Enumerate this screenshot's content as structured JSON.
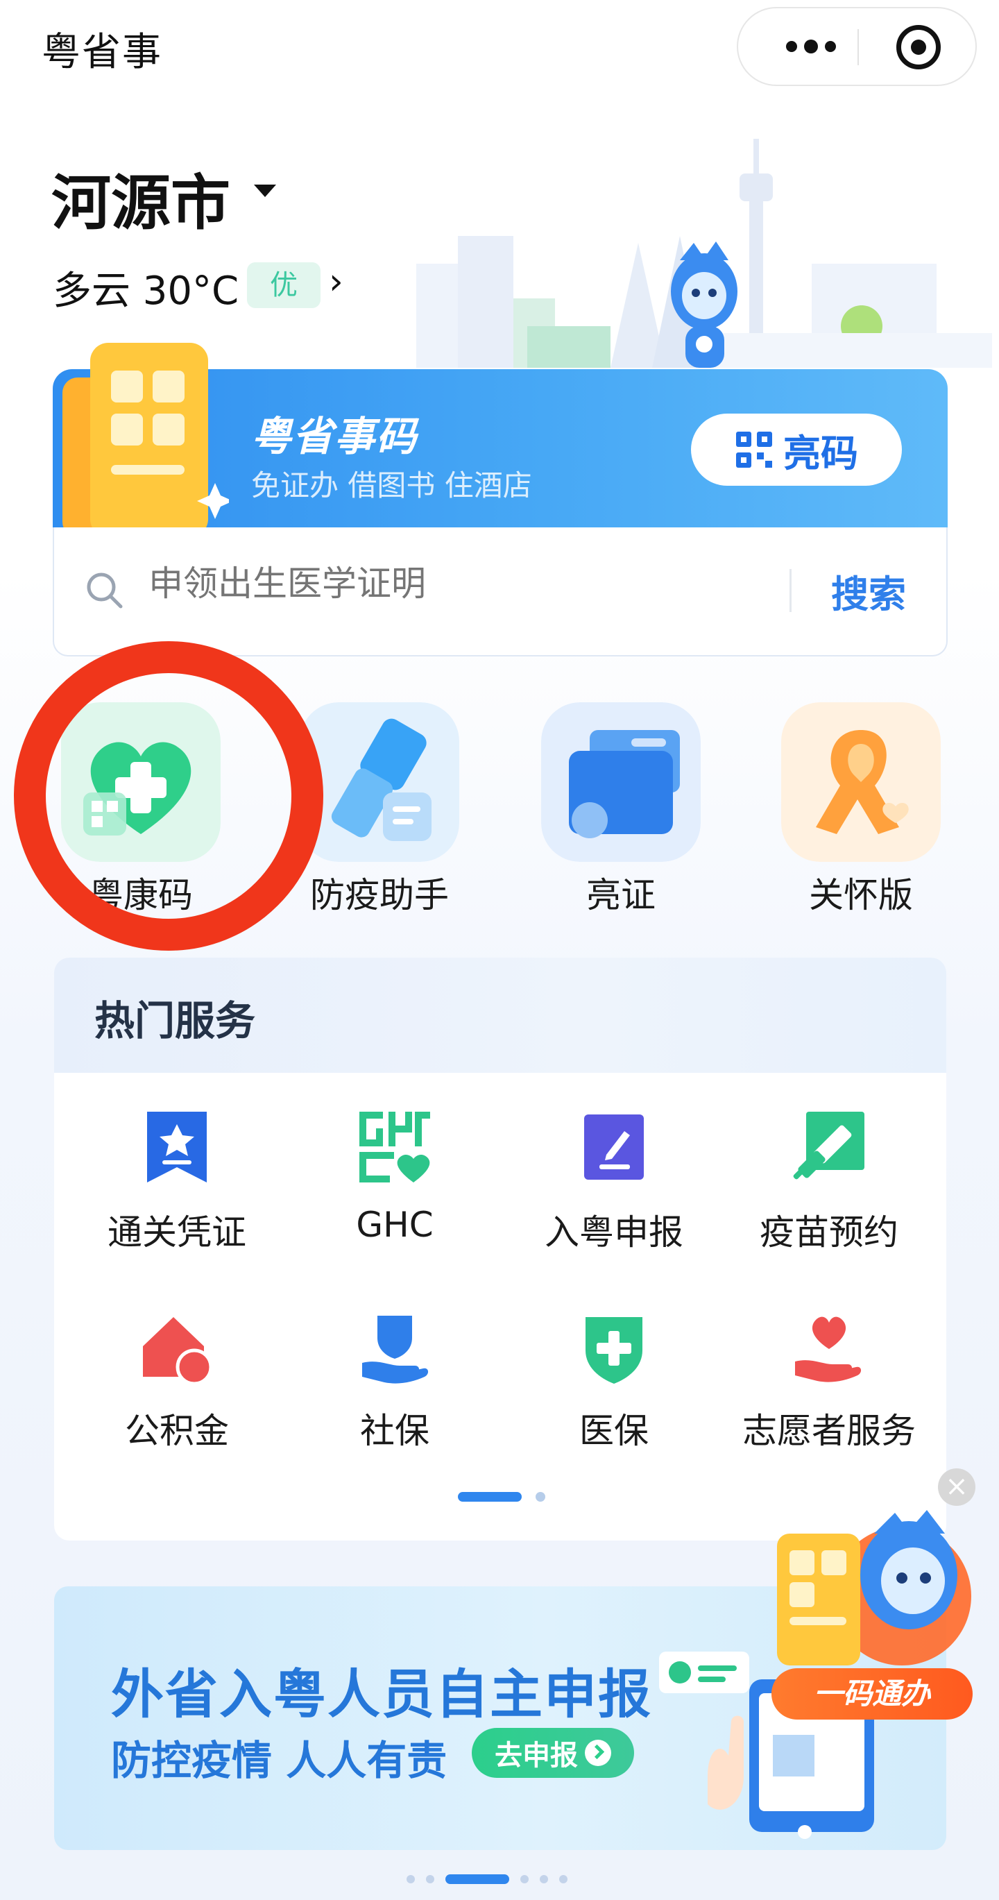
{
  "header": {
    "app_title": "粤省事"
  },
  "location": {
    "city": "河源市",
    "weather": "多云 30°C",
    "aqi": "优",
    "arrow": "›"
  },
  "banner": {
    "title": "粤省事码",
    "subtitle": "免证办 借图书 住酒店",
    "show_button": "亮码"
  },
  "search": {
    "placeholder": "申领出生医学证明",
    "button": "搜索"
  },
  "quick_services": [
    {
      "label": "粤康码",
      "icon": "heart-plus-icon",
      "color": "#2fcf8a"
    },
    {
      "label": "防疫助手",
      "icon": "spray-icon",
      "color": "#38a3f6"
    },
    {
      "label": "亮证",
      "icon": "wallet-card-icon",
      "color": "#2f7fea"
    },
    {
      "label": "关怀版",
      "icon": "ribbon-heart-icon",
      "color": "#ffa13d"
    }
  ],
  "hot_services": {
    "title": "热门服务",
    "items": [
      {
        "label": "通关凭证",
        "icon": "ticket-star-icon",
        "color": "#2869e4"
      },
      {
        "label": "GHC",
        "icon": "ghc-heart-icon",
        "color": "#2dc58a"
      },
      {
        "label": "入粤申报",
        "icon": "edit-form-icon",
        "color": "#5a56e0"
      },
      {
        "label": "疫苗预约",
        "icon": "syringe-icon",
        "color": "#2dc58a"
      },
      {
        "label": "公积金",
        "icon": "house-coin-icon",
        "color": "#ee5150"
      },
      {
        "label": "社保",
        "icon": "person-hand-icon",
        "color": "#2f7fea"
      },
      {
        "label": "医保",
        "icon": "shield-plus-icon",
        "color": "#2dc58a"
      },
      {
        "label": "志愿者服务",
        "icon": "heart-hand-icon",
        "color": "#ee5150"
      }
    ]
  },
  "promo": {
    "title": "外省入粤人员自主申报",
    "subtitle": "防控疫情 人人有责",
    "button": "去申报"
  },
  "floating": {
    "tag": "一码通办",
    "close": "×"
  }
}
